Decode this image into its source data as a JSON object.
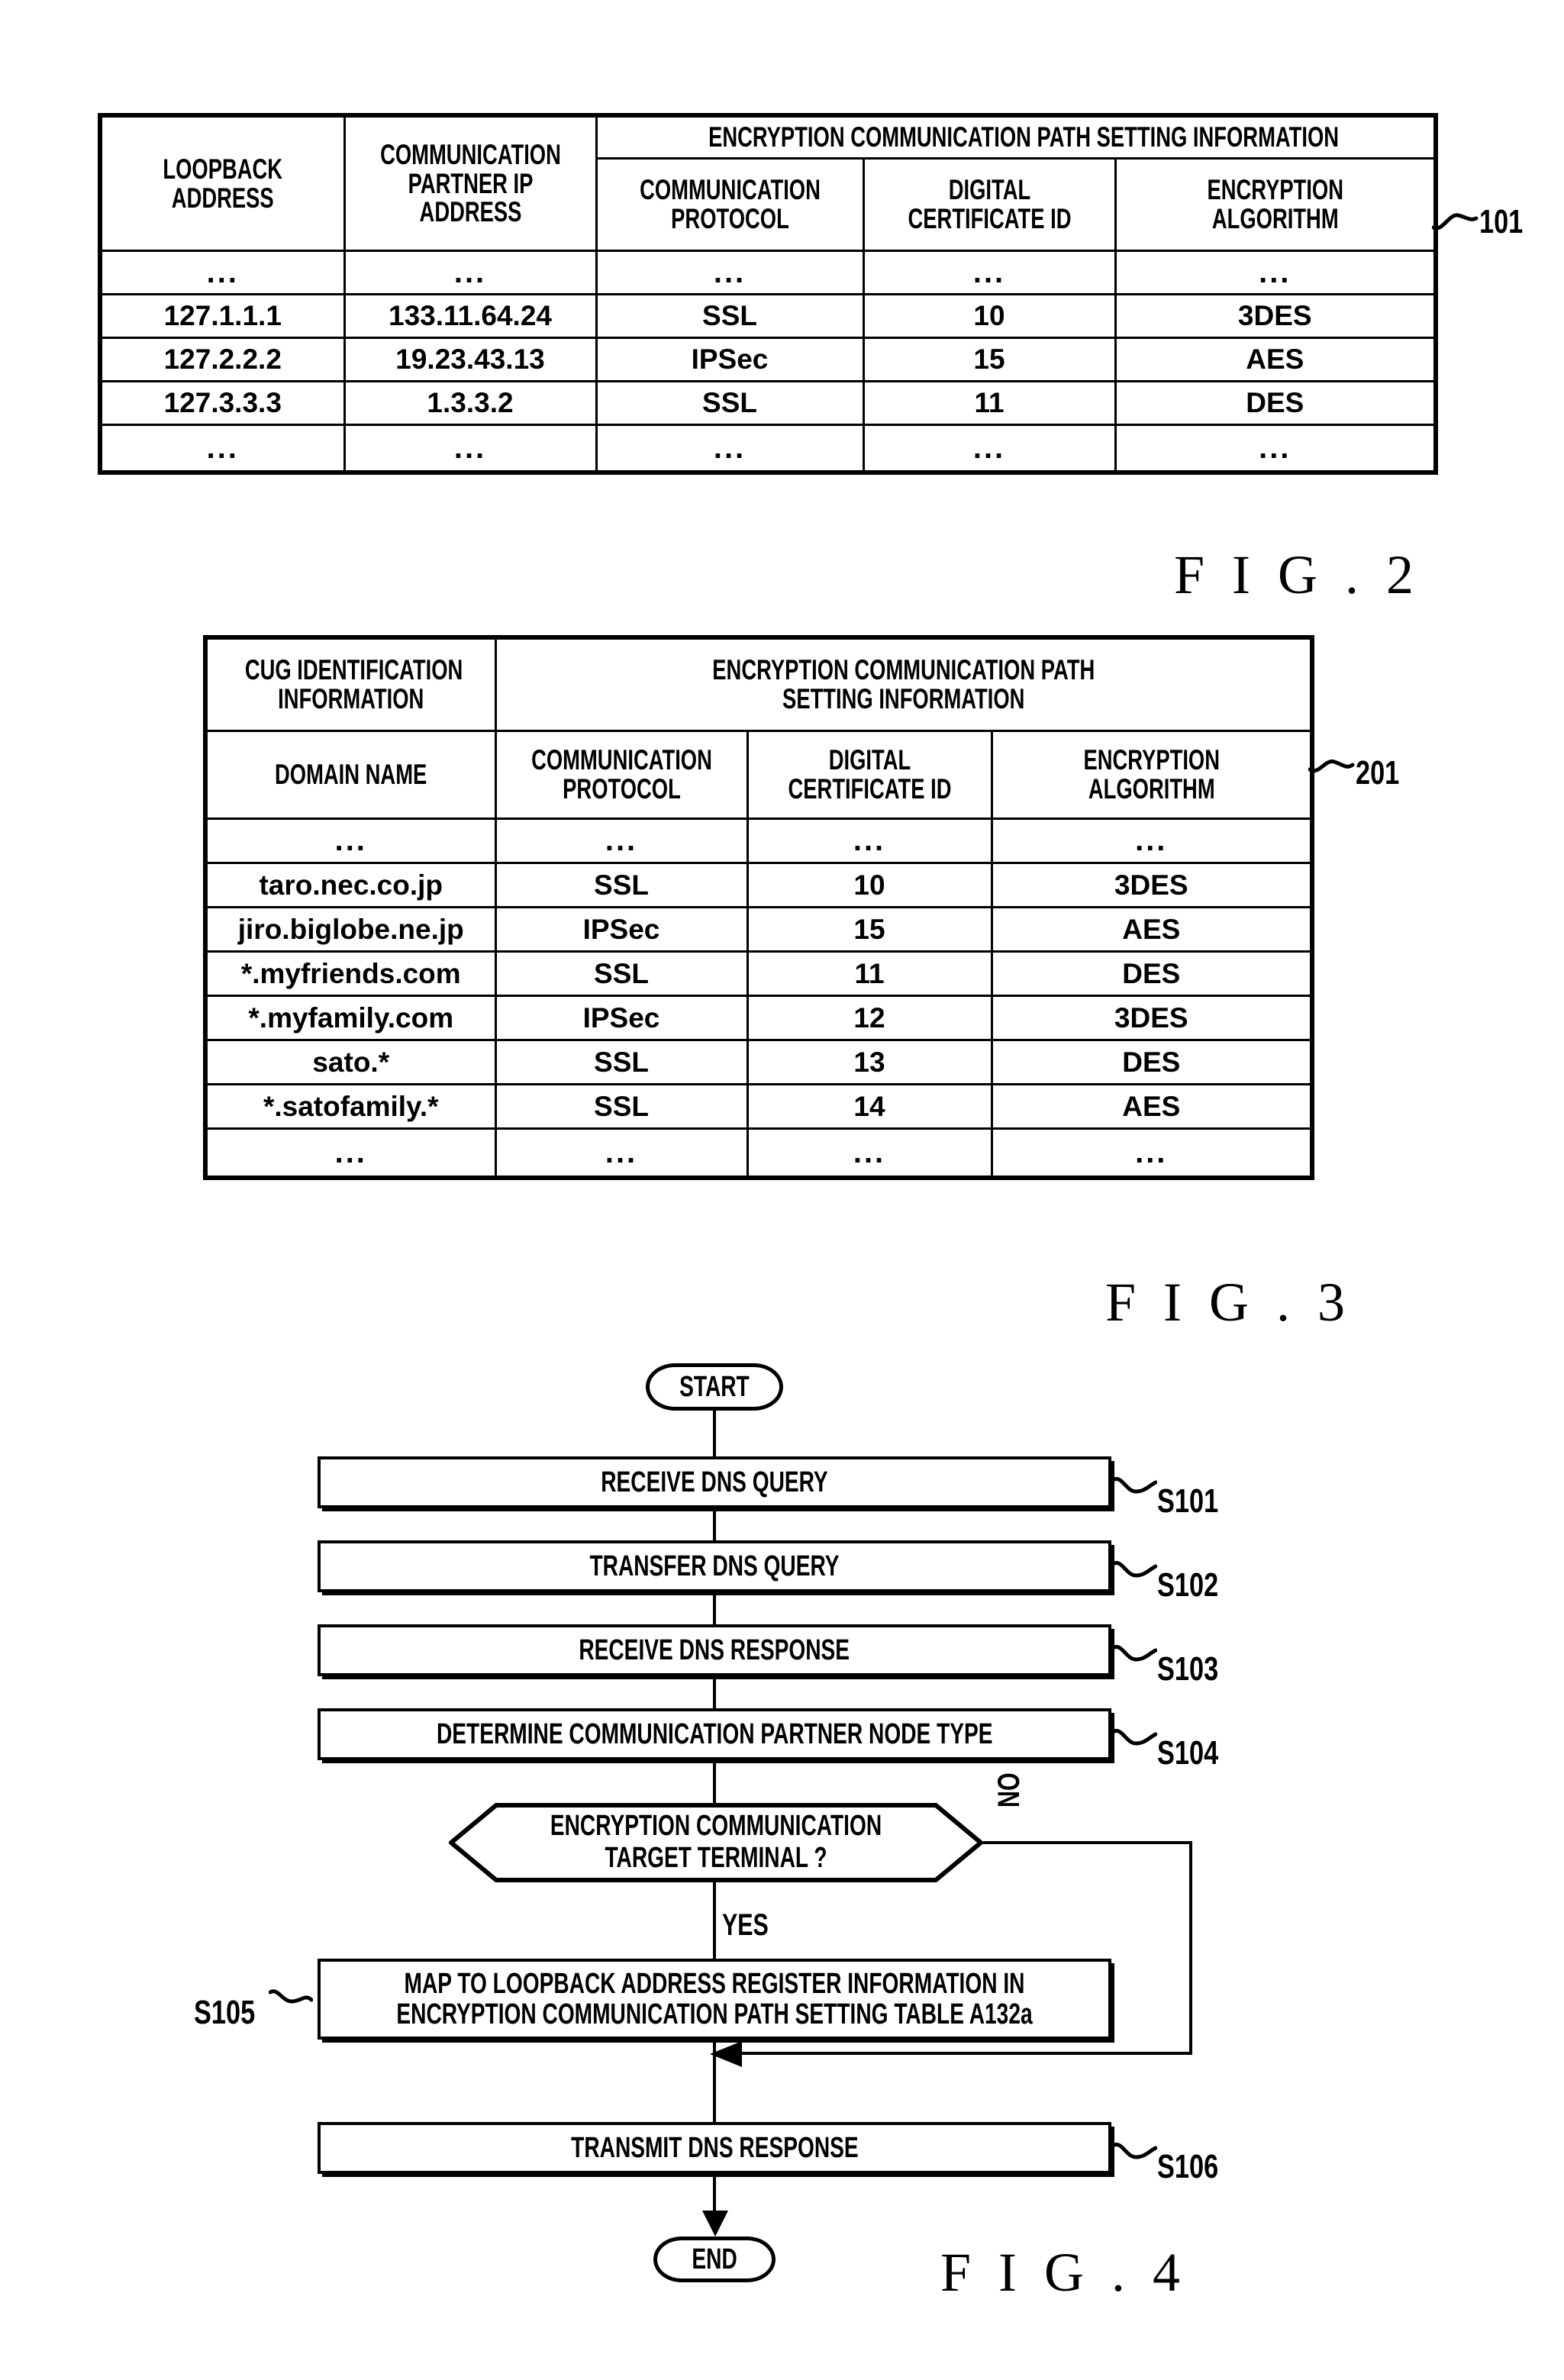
{
  "figure2": {
    "ref_label": "101",
    "caption": "F I G . 2",
    "headers": {
      "loopback_address": [
        "LOOPBACK",
        "ADDRESS"
      ],
      "partner_ip": [
        "COMMUNICATION",
        "PARTNER IP",
        "ADDRESS"
      ],
      "group_title": "ENCRYPTION COMMUNICATION PATH SETTING INFORMATION",
      "comm_protocol": [
        "COMMUNICATION",
        "PROTOCOL"
      ],
      "digital_cert_id": [
        "DIGITAL",
        "CERTIFICATE ID"
      ],
      "encryption_algorithm": [
        "ENCRYPTION",
        "ALGORITHM"
      ]
    },
    "ellipsis": "...",
    "rows": [
      [
        "...",
        "...",
        "...",
        "...",
        "..."
      ],
      [
        "127.1.1.1",
        "133.11.64.24",
        "SSL",
        "10",
        "3DES"
      ],
      [
        "127.2.2.2",
        "19.23.43.13",
        "IPSec",
        "15",
        "AES"
      ],
      [
        "127.3.3.3",
        "1.3.3.2",
        "SSL",
        "11",
        "DES"
      ],
      [
        "...",
        "...",
        "...",
        "...",
        "..."
      ]
    ]
  },
  "figure3": {
    "ref_label": "201",
    "caption": "F I G . 3",
    "headers": {
      "cug_identification": [
        "CUG IDENTIFICATION",
        "INFORMATION"
      ],
      "group_title": [
        "ENCRYPTION COMMUNICATION PATH",
        "SETTING INFORMATION"
      ],
      "domain_name": "DOMAIN NAME",
      "comm_protocol": [
        "COMMUNICATION",
        "PROTOCOL"
      ],
      "digital_cert_id": [
        "DIGITAL",
        "CERTIFICATE ID"
      ],
      "encryption_algorithm": [
        "ENCRYPTION",
        "ALGORITHM"
      ]
    },
    "rows": [
      [
        "...",
        "...",
        "...",
        "..."
      ],
      [
        "taro.nec.co.jp",
        "SSL",
        "10",
        "3DES"
      ],
      [
        "jiro.biglobe.ne.jp",
        "IPSec",
        "15",
        "AES"
      ],
      [
        "*.myfriends.com",
        "SSL",
        "11",
        "DES"
      ],
      [
        "*.myfamily.com",
        "IPSec",
        "12",
        "3DES"
      ],
      [
        "sato.*",
        "SSL",
        "13",
        "DES"
      ],
      [
        "*.satofamily.*",
        "SSL",
        "14",
        "AES"
      ],
      [
        "...",
        "...",
        "...",
        "..."
      ]
    ]
  },
  "figure4": {
    "caption": "F I G . 4",
    "start": "START",
    "end": "END",
    "steps": [
      {
        "id": "S101",
        "label": "RECEIVE DNS QUERY"
      },
      {
        "id": "S102",
        "label": "TRANSFER DNS QUERY"
      },
      {
        "id": "S103",
        "label": "RECEIVE DNS RESPONSE"
      },
      {
        "id": "S104",
        "label": "DETERMINE COMMUNICATION PARTNER NODE TYPE"
      }
    ],
    "decision": {
      "line1": "ENCRYPTION COMMUNICATION",
      "line2": "TARGET TERMINAL ?",
      "yes": "YES",
      "no": "NO"
    },
    "step_s105": {
      "id": "S105",
      "line1": "MAP TO LOOPBACK ADDRESS REGISTER INFORMATION IN",
      "line2": "ENCRYPTION COMMUNICATION PATH SETTING TABLE A132a"
    },
    "step_s106": {
      "id": "S106",
      "label": "TRANSMIT DNS RESPONSE"
    }
  }
}
